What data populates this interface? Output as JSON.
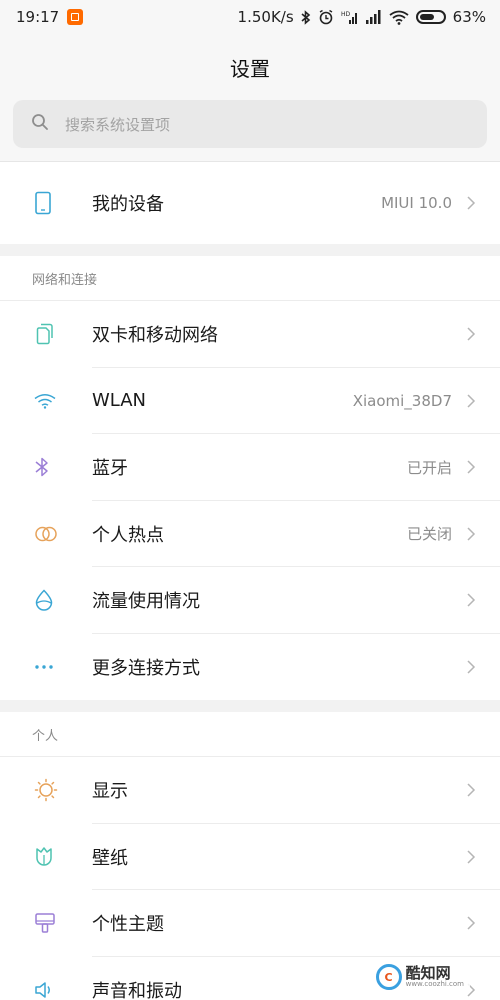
{
  "status_bar": {
    "time": "19:17",
    "speed": "1.50K/s",
    "battery": "63%",
    "battery_level": 0.63
  },
  "header": {
    "title": "设置"
  },
  "search": {
    "placeholder": "搜索系统设置项"
  },
  "device": {
    "label": "我的设备",
    "value": "MIUI 10.0"
  },
  "network": {
    "title": "网络和连接",
    "items": [
      {
        "label": "双卡和移动网络",
        "value": "",
        "icon": "sim-icon"
      },
      {
        "label": "WLAN",
        "value": "Xiaomi_38D7",
        "icon": "wifi-icon"
      },
      {
        "label": "蓝牙",
        "value": "已开启",
        "icon": "bluetooth-icon"
      },
      {
        "label": "个人热点",
        "value": "已关闭",
        "icon": "hotspot-icon"
      },
      {
        "label": "流量使用情况",
        "value": "",
        "icon": "data-usage-icon"
      },
      {
        "label": "更多连接方式",
        "value": "",
        "icon": "more-dots-icon"
      }
    ]
  },
  "personal": {
    "title": "个人",
    "items": [
      {
        "label": "显示",
        "icon": "display-icon"
      },
      {
        "label": "壁纸",
        "icon": "wallpaper-icon"
      },
      {
        "label": "个性主题",
        "icon": "theme-icon"
      },
      {
        "label": "声音和振动",
        "icon": "sound-icon"
      }
    ]
  },
  "watermark": {
    "title": "酷知网",
    "url": "www.coozhi.com",
    "logo_text": "C"
  },
  "colors": {
    "accent_blue": "#3aa6d4",
    "notif_orange": "#ff6a00"
  }
}
